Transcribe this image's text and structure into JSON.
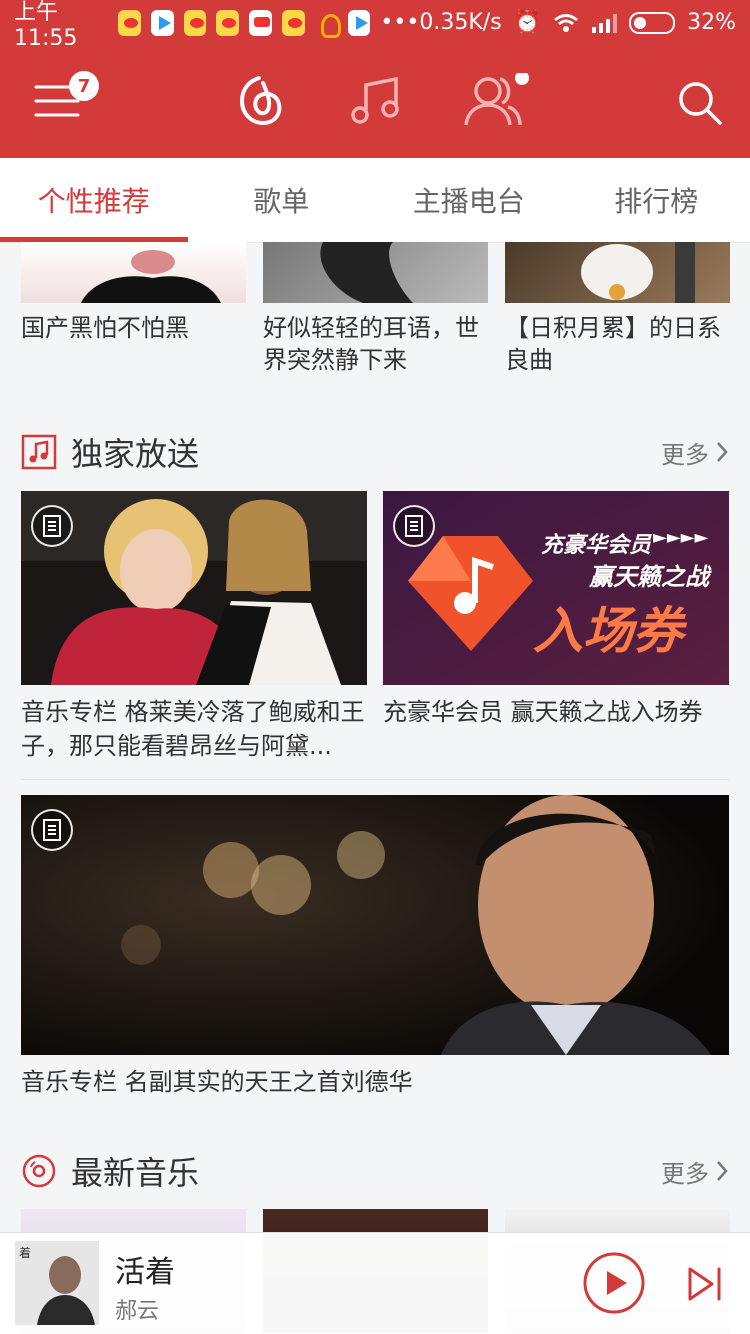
{
  "status_bar": {
    "time": "上午11:55",
    "speed": "0.35K/s",
    "battery": "32%"
  },
  "header": {
    "notification_count": "7"
  },
  "tabs": [
    {
      "label": "个性推荐",
      "active": true
    },
    {
      "label": "歌单"
    },
    {
      "label": "主播电台"
    },
    {
      "label": "排行榜"
    }
  ],
  "playlists": [
    {
      "title": "国产黑怕不怕黑"
    },
    {
      "title": "好似轻轻的耳语，世界突然静下来"
    },
    {
      "title": "【日积月累】的日系良曲"
    }
  ],
  "exclusive": {
    "title": "独家放送",
    "more": "更多",
    "items": [
      {
        "title": "音乐专栏 格莱美冷落了鲍威和王子，那只能看碧昂丝与阿黛..."
      },
      {
        "title": "充豪华会员 赢天籁之战入场券"
      },
      {
        "title": "音乐专栏 名副其实的天王之首刘德华"
      }
    ],
    "promo": {
      "line1": "充豪华会员",
      "line2": "赢天籁之战",
      "line3": "入场券"
    }
  },
  "new_music": {
    "title": "最新音乐",
    "more": "更多"
  },
  "player": {
    "title": "活着",
    "artist": "郝云"
  }
}
